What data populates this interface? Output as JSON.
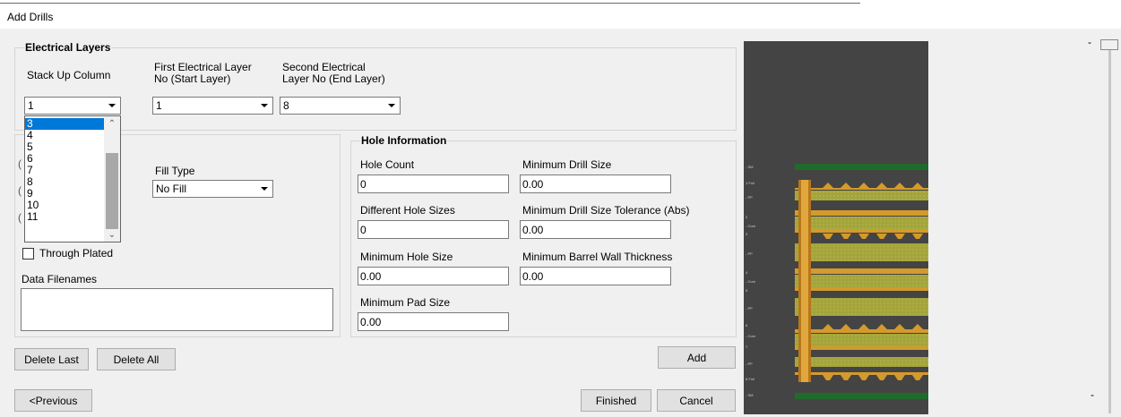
{
  "window": {
    "title": "Add Drills"
  },
  "electrical_layers": {
    "legend": "Electrical Layers",
    "stack_up_column_label": "Stack Up Column",
    "stack_up_column_value": "1",
    "first_layer_label_line1": "First Electrical Layer",
    "first_layer_label_line2": "No  (Start Layer)",
    "first_layer_value": "1",
    "second_layer_label_line1": "Second Electrical",
    "second_layer_label_line2": "Layer No  (End Layer)",
    "second_layer_value": "8"
  },
  "dropdown": {
    "options": [
      "3",
      "4",
      "5",
      "6",
      "7",
      "8",
      "9",
      "10",
      "11"
    ],
    "selected": "3"
  },
  "drill_options": {
    "fill_type_label": "Fill Type",
    "fill_type_value": "No Fill",
    "through_plated_label": "Through Plated",
    "data_filenames_label": "Data Filenames",
    "data_filenames_value": ""
  },
  "hole_information": {
    "legend": "Hole Information",
    "hole_count_label": "Hole Count",
    "hole_count_value": "0",
    "min_drill_size_label": "Minimum Drill Size",
    "min_drill_size_value": "0.00",
    "diff_hole_sizes_label": "Different Hole Sizes",
    "diff_hole_sizes_value": "0",
    "min_drill_tol_label": "Minimum Drill Size Tolerance (Abs)",
    "min_drill_tol_value": "0.00",
    "min_hole_size_label": "Minimum Hole Size",
    "min_hole_size_value": "0.00",
    "min_barrel_label": "Minimum Barrel Wall Thickness",
    "min_barrel_value": "0.00",
    "min_pad_label": "Minimum Pad Size",
    "min_pad_value": "0.00"
  },
  "buttons": {
    "delete_last": "Delete Last",
    "delete_all": "Delete All",
    "add": "Add",
    "previous": "<Previous",
    "finished": "Finished",
    "cancel": "Cancel"
  },
  "stackup_preview": {
    "layer_labels": [
      "- SM",
      "1 Foil",
      "- PP",
      "2",
      "- Core",
      "3",
      "- PP",
      "4",
      "- Core",
      "5",
      "- PP",
      "6",
      "- Core",
      "7",
      "- PP",
      "8 Foil",
      "- SM"
    ],
    "colors": {
      "soldermask": "#1f6b2a",
      "copper": "#d49a2c",
      "prepreg": "#a3a53c",
      "drill": "#e0a83c"
    }
  },
  "slider": {
    "top_mark": "-",
    "bottom_mark": "-"
  }
}
